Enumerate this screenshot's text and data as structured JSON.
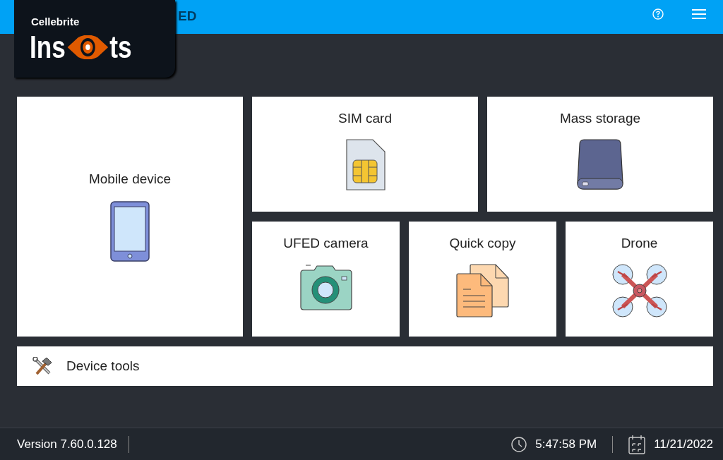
{
  "header": {
    "title": "ED",
    "logo": {
      "brand": "Cellebrite",
      "word_start": "Ins",
      "word_end": "ts"
    }
  },
  "tiles": [
    {
      "label": "Mobile device",
      "kind": "mobile"
    },
    {
      "label": "SIM card",
      "kind": "sim"
    },
    {
      "label": "Mass storage",
      "kind": "storage"
    },
    {
      "label": "UFED camera",
      "kind": "camera"
    },
    {
      "label": "Quick copy",
      "kind": "copy"
    },
    {
      "label": "Drone",
      "kind": "drone"
    }
  ],
  "tools": {
    "label": "Device tools"
  },
  "status_bar": {
    "version": "Version 7.60.0.128",
    "time": "5:47:58 PM",
    "date": "11/21/2022"
  }
}
